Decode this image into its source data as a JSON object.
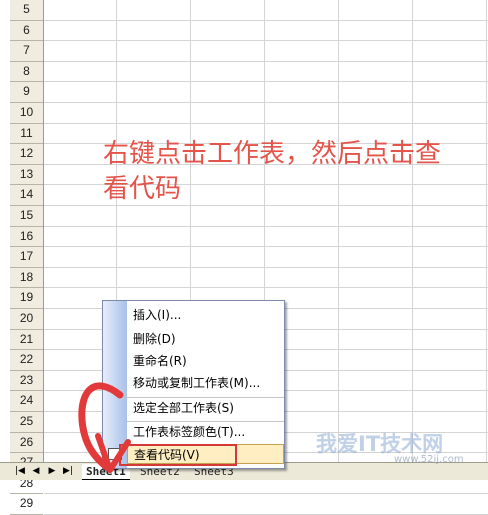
{
  "row_numbers": [
    "5",
    "6",
    "7",
    "8",
    "9",
    "10",
    "11",
    "12",
    "13",
    "14",
    "15",
    "16",
    "17",
    "18",
    "19",
    "20",
    "21",
    "22",
    "23",
    "24",
    "25",
    "26",
    "27",
    "28",
    "29"
  ],
  "annotation": {
    "line1": "右键点击工作表，然后点击查",
    "line2": "看代码"
  },
  "sheet_tabs": {
    "tab1": "Sheet1",
    "tab2": "Sheet2",
    "tab3": "Sheet3"
  },
  "nav_buttons": {
    "first": "|◀",
    "prev": "◀",
    "next": "▶",
    "last": "▶|"
  },
  "context_menu": {
    "insert": "插入(I)...",
    "delete": "删除(D)",
    "rename": "重命名(R)",
    "move_copy": "移动或复制工作表(M)...",
    "select_all": "选定全部工作表(S)",
    "tab_color": "工作表标签颜色(T)...",
    "view_code": "查看代码(V)"
  },
  "watermark": {
    "text": "我爱IT技术网",
    "url": "www.52ij.com"
  },
  "colors": {
    "annotation": "#e4544a",
    "highlight_box": "#d63838",
    "menu_highlight": "#ffeec2"
  }
}
